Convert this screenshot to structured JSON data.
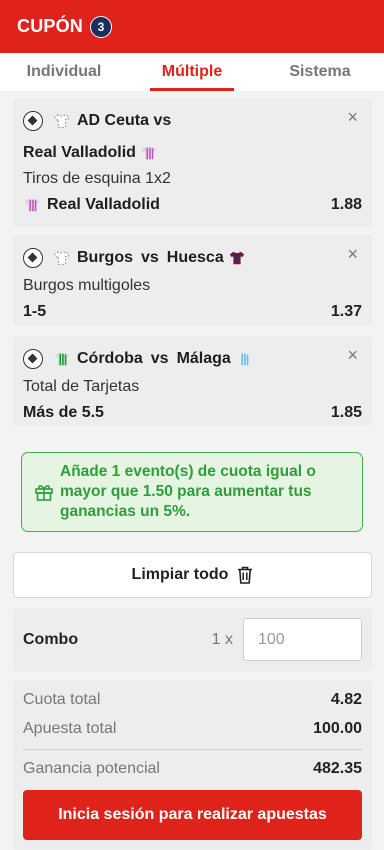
{
  "header": {
    "title": "CUPÓN",
    "badge_count": "3"
  },
  "tabs": [
    {
      "label": "Individual",
      "active": false
    },
    {
      "label": "Múltiple",
      "active": true
    },
    {
      "label": "Sistema",
      "active": false
    }
  ],
  "bets": [
    {
      "match_line1": "AD Ceuta  vs",
      "match_line2": "Real Valladolid",
      "market": "Tiros de esquina 1x2",
      "selection": "Real Valladolid",
      "odds": "1.88",
      "close": "×"
    },
    {
      "home": "Burgos",
      "vs": "vs",
      "away": "Huesca",
      "market": "Burgos multigoles",
      "selection": "1-5",
      "odds": "1.37",
      "close": "×"
    },
    {
      "home": "Córdoba",
      "vs": "vs",
      "away": "Málaga",
      "market": "Total de Tarjetas",
      "selection": "Más de 5.5",
      "odds": "1.85",
      "close": "×"
    }
  ],
  "promo": {
    "text": "Añade 1 evento(s) de cuota igual o mayor que 1.50 para aumentar tus ganancias un 5%."
  },
  "clear_button": "Limpiar todo",
  "combo": {
    "label": "Combo",
    "multiplier": "1 x",
    "placeholder": "100"
  },
  "summary": {
    "total_odds_label": "Cuota total",
    "total_odds_value": "4.82",
    "total_stake_label": "Apuesta total",
    "total_stake_value": "100.00",
    "potential_label": "Ganancia potencial",
    "potential_value": "482.35"
  },
  "cta_label": "Inicia sesión para realizar apuestas",
  "colors": {
    "brand": "#e0231a",
    "badge": "#1b2e5e",
    "promo_green": "#3fb24b",
    "valladolid": "#b257b8",
    "huesca": "#6b1b3a",
    "cordoba": "#1f9b3a",
    "malaga": "#74b7e3"
  }
}
